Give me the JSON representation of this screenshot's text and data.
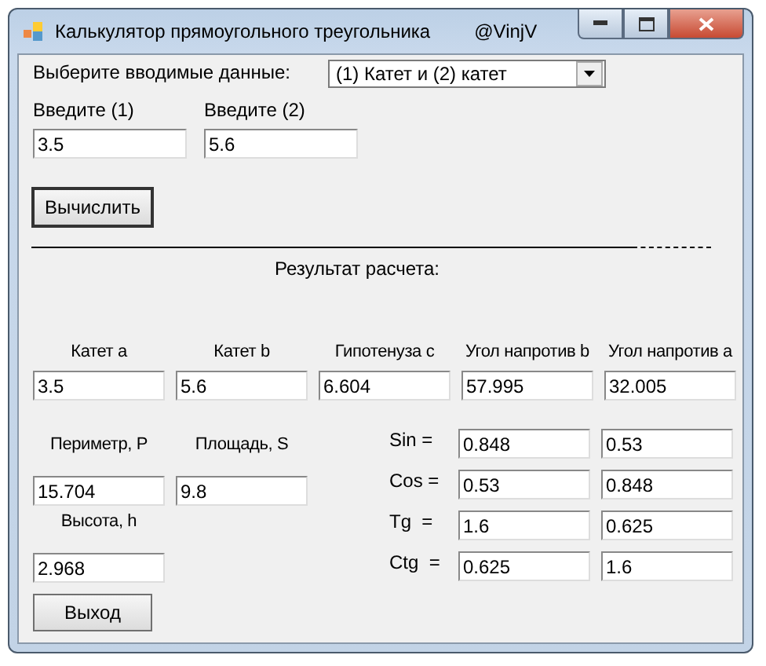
{
  "window": {
    "title": "Калькулятор прямоугольного треугольника",
    "author": "@VinjV"
  },
  "input_type": {
    "label": "Выберите вводимые данные:",
    "value": "(1) Катет и (2) катет"
  },
  "inputs": [
    {
      "label": "Введите (1)",
      "value": "3.5"
    },
    {
      "label": "Введите (2)",
      "value": "5.6"
    }
  ],
  "calculate_button": "Вычислить",
  "result_title": "Результат расчета:",
  "sides": [
    {
      "label": "Катет a",
      "value": "3.5"
    },
    {
      "label": "Катет b",
      "value": "5.6"
    },
    {
      "label": "Гипотенуза c",
      "value": "6.604"
    },
    {
      "label": "Угол напротив b",
      "value": "57.995"
    },
    {
      "label": "Угол напротив a",
      "value": "32.005"
    }
  ],
  "perimeter_area": [
    {
      "label": "Периметр, P",
      "value": "15.704"
    },
    {
      "label": "Площадь, S",
      "value": "9.8"
    }
  ],
  "height": {
    "label": "Высота, h",
    "value": "2.968"
  },
  "trig": [
    {
      "label": "Sin =",
      "values": [
        "0.848",
        "0.53"
      ]
    },
    {
      "label": "Cos =",
      "values": [
        "0.53",
        "0.848"
      ]
    },
    {
      "label": "Tg  =",
      "values": [
        "1.6",
        "0.625"
      ]
    },
    {
      "label": "Ctg  =",
      "values": [
        "0.625",
        "1.6"
      ]
    }
  ],
  "exit_button": "Выход"
}
